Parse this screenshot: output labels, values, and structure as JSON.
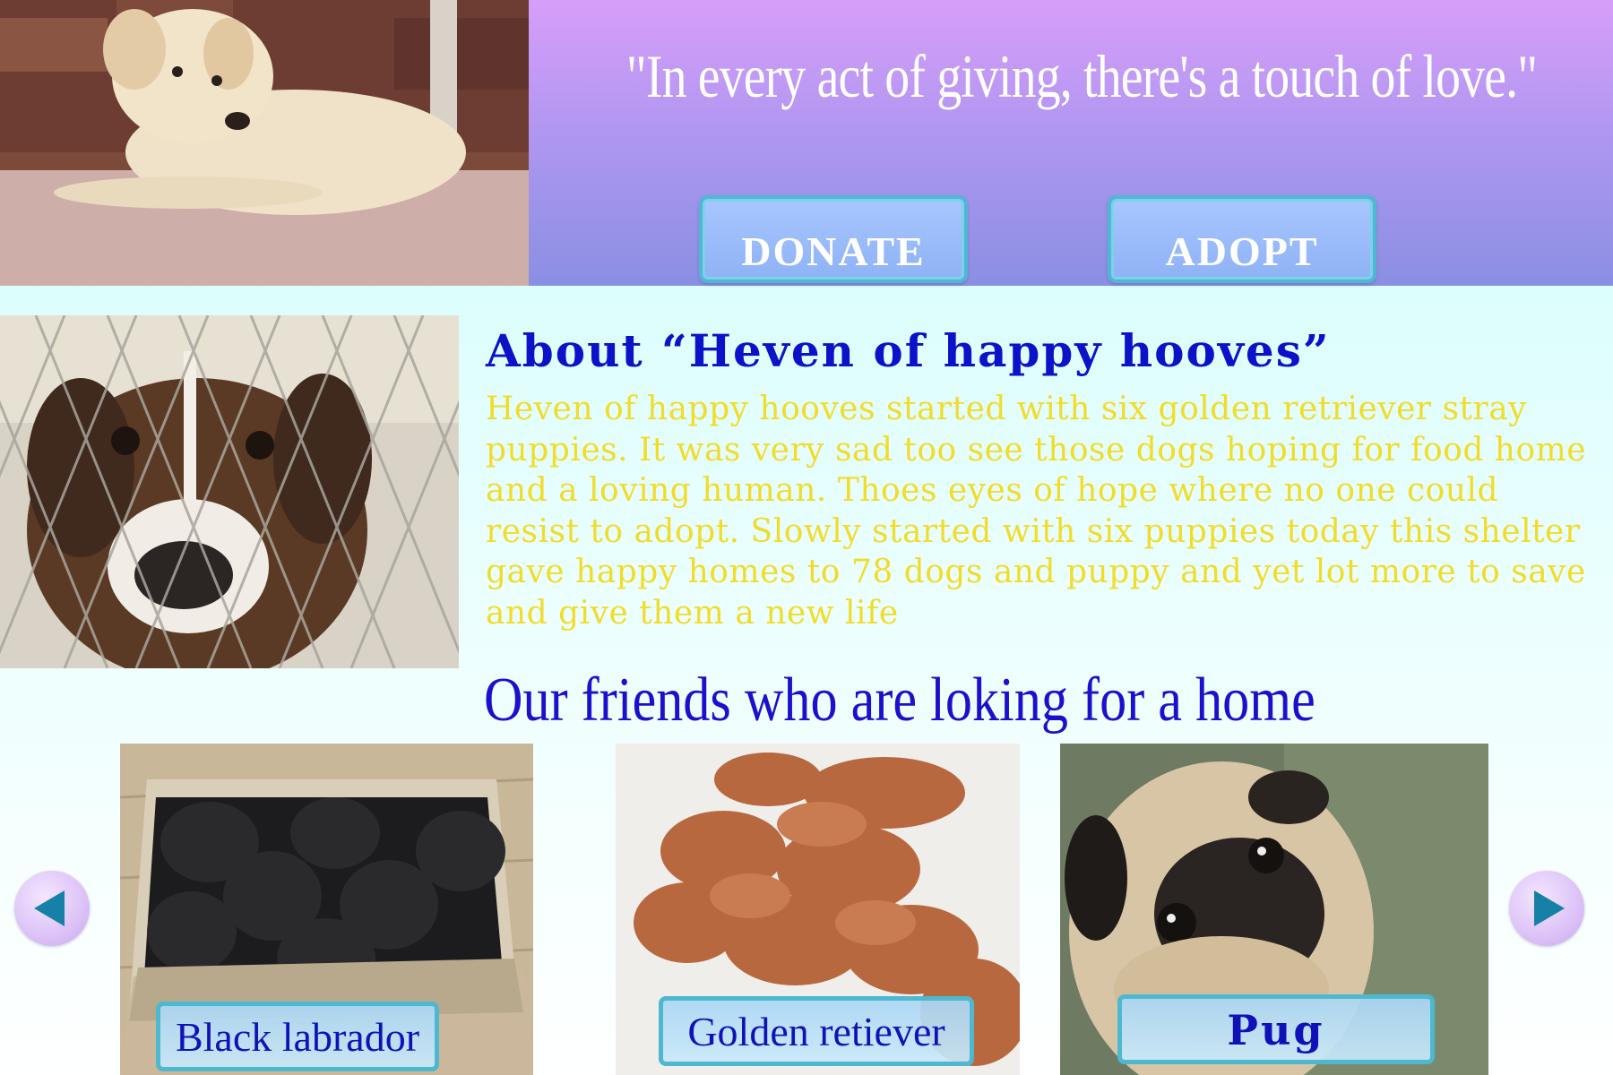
{
  "header": {
    "quote": "\"In every act of giving, there's a touch of love.\"",
    "donate_label": "DONATE",
    "adopt_label": "ADOPT"
  },
  "about": {
    "title": "About “Heven of happy hooves”",
    "body": "Heven of happy hooves started with six golden retriever stray puppies. It was very sad too see those dogs hoping for food home and a loving human. Thoes eyes of hope where no one could resist to adopt. Slowly started with six puppies today this shelter gave happy homes to 78 dogs and puppy and yet lot more to save and give them a new life"
  },
  "friends": {
    "title": "Our friends who are loking for a home",
    "cards": [
      {
        "label": "Black labrador"
      },
      {
        "label": "Golden retiever"
      },
      {
        "label": "Pug"
      }
    ]
  },
  "icons": {
    "prev": "left-triangle-icon",
    "next": "right-triangle-icon"
  },
  "colors": {
    "header_top": "#d79ef9",
    "header_bottom": "#8a8fe3",
    "about_title": "#0b12c8",
    "about_body": "#f1dc2a",
    "friends_title": "#1b10cc",
    "arrow": "#1680a6"
  }
}
